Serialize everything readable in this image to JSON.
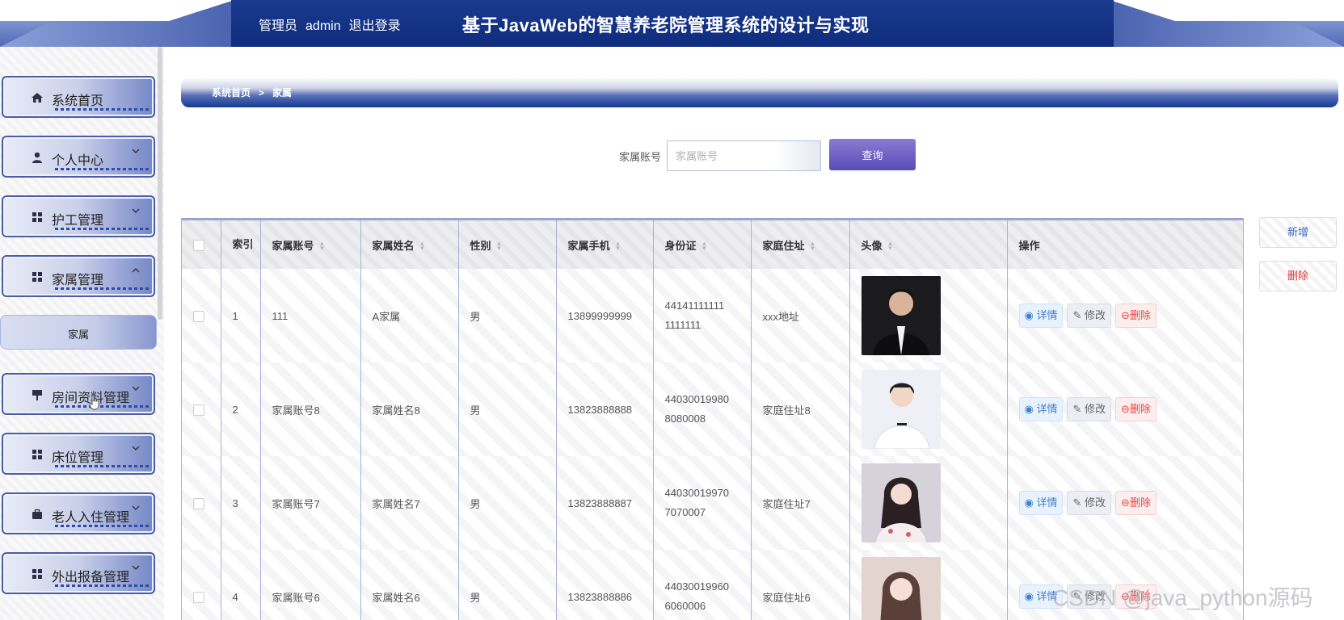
{
  "header": {
    "role": "管理员",
    "username": "admin",
    "logout": "退出登录",
    "title": "基于JavaWeb的智慧养老院管理系统的设计与实现"
  },
  "sidebar": {
    "items": [
      {
        "label": "系统首页",
        "icon": "home-icon"
      },
      {
        "label": "个人中心",
        "icon": "user-icon"
      },
      {
        "label": "护工管理",
        "icon": "grid-icon"
      },
      {
        "label": "家属管理",
        "icon": "grid-icon"
      },
      {
        "label": "房间资料管理",
        "icon": "signpost-icon"
      },
      {
        "label": "床位管理",
        "icon": "grid-icon"
      },
      {
        "label": "老人入住管理",
        "icon": "briefcase-icon"
      },
      {
        "label": "外出报备管理",
        "icon": "grid-icon"
      }
    ],
    "sub_item": "家属"
  },
  "breadcrumb": {
    "home": "系统首页",
    "sep": ">",
    "current": "家属"
  },
  "search": {
    "label": "家属账号",
    "placeholder": "家属账号",
    "button": "查询"
  },
  "actions": {
    "add": "新增",
    "delete": "删除"
  },
  "table": {
    "headers": {
      "index": "索引",
      "account": "家属账号",
      "name": "家属姓名",
      "gender": "性别",
      "phone": "家属手机",
      "idcard": "身份证",
      "address": "家庭住址",
      "avatar": "头像",
      "ops": "操作"
    },
    "ops": {
      "detail": "详情",
      "edit": "修改",
      "remove": "删除"
    },
    "rows": [
      {
        "index": "1",
        "account": "111",
        "name": "A家属",
        "gender": "男",
        "phone": "13899999999",
        "idcard_1": "44141111111",
        "idcard_2": "1111111",
        "address": "xxx地址"
      },
      {
        "index": "2",
        "account": "家属账号8",
        "name": "家属姓名8",
        "gender": "男",
        "phone": "13823888888",
        "idcard_1": "44030019980",
        "idcard_2": "8080008",
        "address": "家庭住址8"
      },
      {
        "index": "3",
        "account": "家属账号7",
        "name": "家属姓名7",
        "gender": "男",
        "phone": "13823888887",
        "idcard_1": "44030019970",
        "idcard_2": "7070007",
        "address": "家庭住址7"
      },
      {
        "index": "4",
        "account": "家属账号6",
        "name": "家属姓名6",
        "gender": "男",
        "phone": "13823888886",
        "idcard_1": "44030019960",
        "idcard_2": "6060006",
        "address": "家庭住址6"
      }
    ]
  },
  "watermark": "CSDN @java_python源码"
}
